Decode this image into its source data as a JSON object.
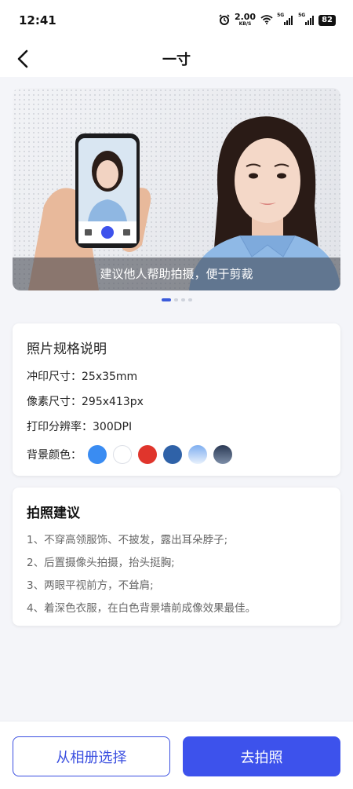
{
  "status_bar": {
    "time": "12:41",
    "speed_value": "2.00",
    "speed_unit": "KB/S",
    "signal_tag_1": "5G",
    "signal_tag_2": "5G",
    "battery": "82"
  },
  "nav": {
    "title": "一寸"
  },
  "banner": {
    "caption": "建议他人帮助拍摄，便于剪裁",
    "page_count": 4,
    "active_page": 1
  },
  "spec": {
    "title": "照片规格说明",
    "print_size": "冲印尺寸：25x35mm",
    "pixel_size": "像素尺寸：295x413px",
    "resolution": "打印分辨率：300DPI",
    "bg_label": "背景颜色：",
    "bg_colors": [
      "#3a8cf2",
      "#ffffff",
      "#e0352c",
      "#2f62a8",
      "gradient-light-blue",
      "gradient-dark-slate"
    ]
  },
  "tips": {
    "title": "拍照建议",
    "items": [
      "1、不穿高领服饰、不披发，露出耳朵脖子;",
      "2、后置摄像头拍摄，抬头挺胸;",
      "3、两眼平视前方，不耸肩;",
      "4、着深色衣服，在白色背景墙前成像效果最佳。"
    ]
  },
  "actions": {
    "album_label": "从相册选择",
    "shoot_label": "去拍照"
  }
}
